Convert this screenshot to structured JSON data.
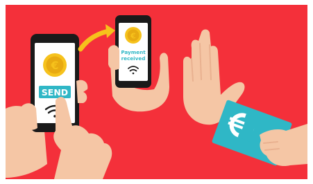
{
  "colors": {
    "background": "#f4303a",
    "phone_body": "#1a1a1a",
    "screen": "#ffffff",
    "coin": "#f6c21c",
    "coin_inner": "#e8aa12",
    "send_button": "#2fb7c6",
    "payment_text": "#2fb7c6",
    "arrow": "#f6c21c",
    "skin": "#f5c6a5",
    "skin_shadow": "#e9b190",
    "banknote": "#2fb7c6"
  },
  "left_phone": {
    "coin_icon": "euro-coin-icon",
    "send_label": "SEND",
    "wifi_icon": "contactless-icon"
  },
  "arrow_icon": "curved-arrow-icon",
  "right_phone": {
    "coin_icon": "euro-coin-icon",
    "status_line1": "Payment",
    "status_line2": "received",
    "wifi_icon": "contactless-icon"
  },
  "stop_hand_icon": "stop-hand-icon",
  "banknote": {
    "icon": "euro-banknote-icon"
  }
}
